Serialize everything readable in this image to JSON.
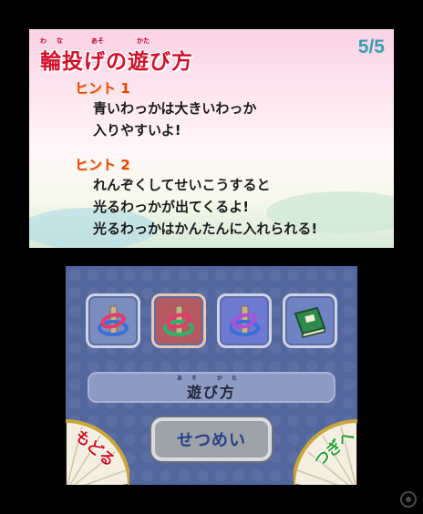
{
  "top": {
    "title": "輪投げの遊び方",
    "title_furigana": [
      "わ",
      "な",
      "あそ",
      "かた"
    ],
    "page_indicator": "5/5",
    "hints": [
      {
        "heading": "ヒント 1",
        "lines": [
          "青いわっかは大きいわっか",
          "入りやすいよ!"
        ]
      },
      {
        "heading": "ヒント 2",
        "lines": [
          "れんぞくしてせいこうすると",
          "光るわっかが出てくるよ!",
          "光るわっかはかんたんに入れられる!"
        ]
      }
    ]
  },
  "bottom": {
    "items": [
      {
        "name": "blue-ring-toss",
        "ring_colors": [
          "#3b6fd8",
          "#e23b6a"
        ]
      },
      {
        "name": "green-ring-toss",
        "ring_colors": [
          "#2fb36a",
          "#e23b6a"
        ]
      },
      {
        "name": "purple-ring-toss",
        "ring_colors": [
          "#3b6fd8",
          "#b04fd8"
        ]
      },
      {
        "name": "rules-book",
        "ring_colors": []
      }
    ],
    "howto_label": "遊び方",
    "howto_furigana": "あそ かた",
    "explain_button": "せつめい",
    "back_fan_label": "もどる",
    "next_fan_label": "つぎへ"
  },
  "colors": {
    "title_red": "#d0102a",
    "page_indicator_teal": "#3a9db2",
    "hint_orange": "#e2470f",
    "bottom_bg": "#53679f",
    "button_text_blue": "#2a3f86"
  }
}
